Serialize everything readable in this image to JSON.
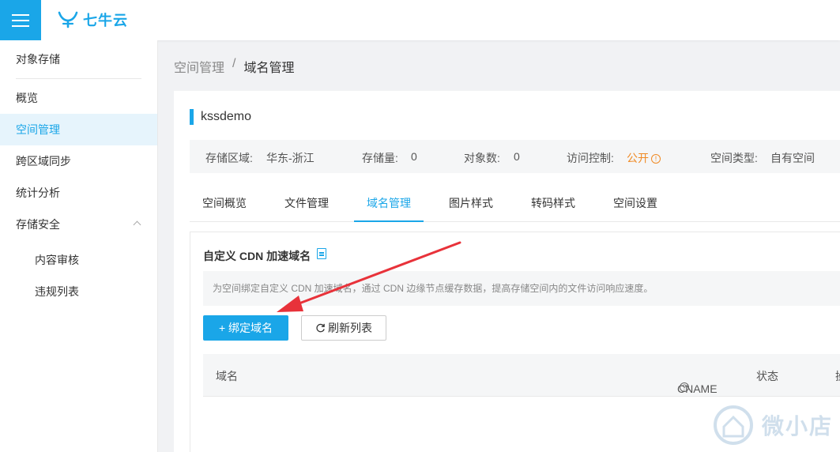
{
  "header": {
    "brand": "七牛云"
  },
  "sidebar": {
    "title": "对象存储",
    "items": [
      {
        "label": "概览"
      },
      {
        "label": "空间管理"
      },
      {
        "label": "跨区域同步"
      },
      {
        "label": "统计分析"
      },
      {
        "label": "存储安全"
      }
    ],
    "sub_items": [
      {
        "label": "内容审核"
      },
      {
        "label": "违规列表"
      }
    ]
  },
  "breadcrumb": {
    "parent": "空间管理",
    "separator": "/",
    "current": "域名管理"
  },
  "bucket": {
    "name": "kssdemo",
    "region_label": "存储区域:",
    "region_value": "华东-浙江",
    "storage_label": "存储量:",
    "storage_value": "0",
    "objects_label": "对象数:",
    "objects_value": "0",
    "access_label": "访问控制:",
    "access_value": "公开",
    "type_label": "空间类型:",
    "type_value": "自有空间"
  },
  "tabs": [
    {
      "label": "空间概览"
    },
    {
      "label": "文件管理"
    },
    {
      "label": "域名管理"
    },
    {
      "label": "图片样式"
    },
    {
      "label": "转码样式"
    },
    {
      "label": "空间设置"
    }
  ],
  "panel": {
    "title": "自定义 CDN 加速域名",
    "description": "为空间绑定自定义 CDN 加速域名，通过 CDN 边缘节点缓存数据，提高存储空间内的文件访问响应速度。",
    "bind_button": "+ 绑定域名",
    "refresh_button": "刷新列表"
  },
  "table": {
    "columns": [
      "域名",
      "CNAME",
      "状态",
      "操"
    ]
  },
  "watermark": {
    "text": "微小店"
  },
  "colors": {
    "accent": "#1aa6e8",
    "warning": "#f08a24",
    "annotation_arrow": "#e8323a"
  }
}
